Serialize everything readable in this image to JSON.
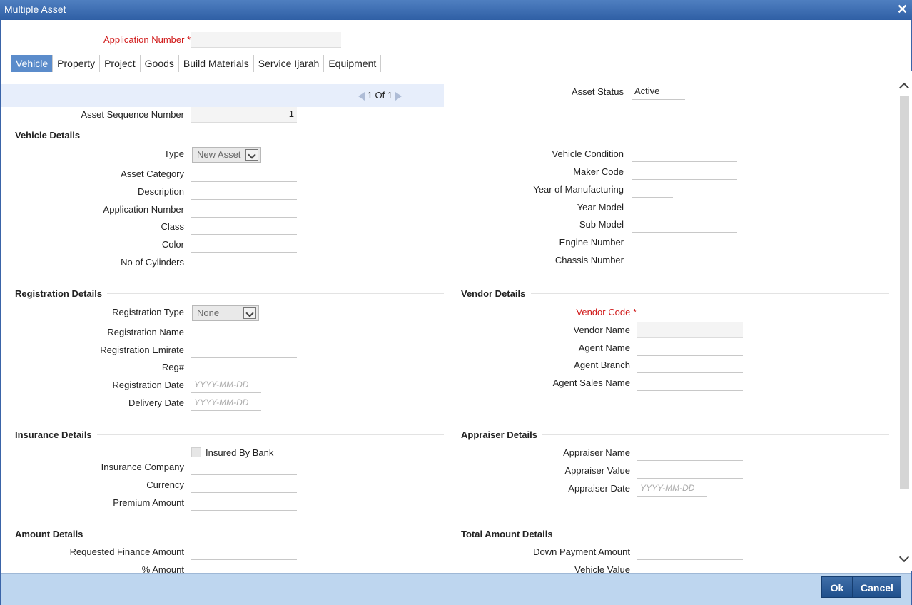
{
  "window": {
    "title": "Multiple Asset"
  },
  "app_number": {
    "label": "Application Number",
    "required_mark": "*",
    "value": ""
  },
  "tabs": [
    {
      "label": "Vehicle",
      "active": true
    },
    {
      "label": "Property"
    },
    {
      "label": "Project"
    },
    {
      "label": "Goods"
    },
    {
      "label": "Build Materials"
    },
    {
      "label": "Service Ijarah"
    },
    {
      "label": "Equipment"
    }
  ],
  "pager": {
    "text": "1 Of 1"
  },
  "asset_status": {
    "label": "Asset Status",
    "value": "Active"
  },
  "asset_seq": {
    "label": "Asset Sequence Number",
    "value": "1"
  },
  "vehicle": {
    "heading": "Vehicle Details",
    "type_label": "Type",
    "type_value": "New Asset",
    "asset_category": "Asset Category",
    "description": "Description",
    "application_number": "Application Number",
    "class": "Class",
    "color": "Color",
    "cylinders": "No of Cylinders",
    "condition": "Vehicle Condition",
    "maker_code": "Maker Code",
    "year_mfg": "Year of Manufacturing",
    "year_model": "Year Model",
    "sub_model": "Sub Model",
    "engine_number": "Engine Number",
    "chassis_number": "Chassis Number"
  },
  "registration": {
    "heading": "Registration Details",
    "type_label": "Registration Type",
    "type_value": "None",
    "name": "Registration Name",
    "emirate": "Registration Emirate",
    "reg_no": "Reg#",
    "date": "Registration Date",
    "delivery_date": "Delivery Date",
    "date_placeholder": "YYYY-MM-DD"
  },
  "vendor": {
    "heading": "Vendor Details",
    "code": "Vendor Code",
    "required_mark": "*",
    "name": "Vendor Name",
    "agent_name": "Agent Name",
    "agent_branch": "Agent Branch",
    "agent_sales_name": "Agent Sales Name"
  },
  "insurance": {
    "heading": "Insurance Details",
    "insured_by_bank": "Insured By Bank",
    "company": "Insurance Company",
    "currency": "Currency",
    "premium": "Premium Amount"
  },
  "appraiser": {
    "heading": "Appraiser Details",
    "name": "Appraiser Name",
    "value": "Appraiser Value",
    "date": "Appraiser Date",
    "date_placeholder": "YYYY-MM-DD"
  },
  "amount": {
    "heading": "Amount Details",
    "requested": "Requested Finance Amount",
    "percent": "% Amount"
  },
  "total_amount": {
    "heading": "Total Amount Details",
    "down_payment": "Down Payment Amount",
    "vehicle_value": "Vehicle Value"
  },
  "buttons": {
    "ok": "Ok",
    "cancel": "Cancel"
  },
  "colors": {
    "title_bar": "#2f5fa5",
    "accent": "#5b8ccb",
    "required": "#d01818",
    "footer": "#bed6ef"
  }
}
